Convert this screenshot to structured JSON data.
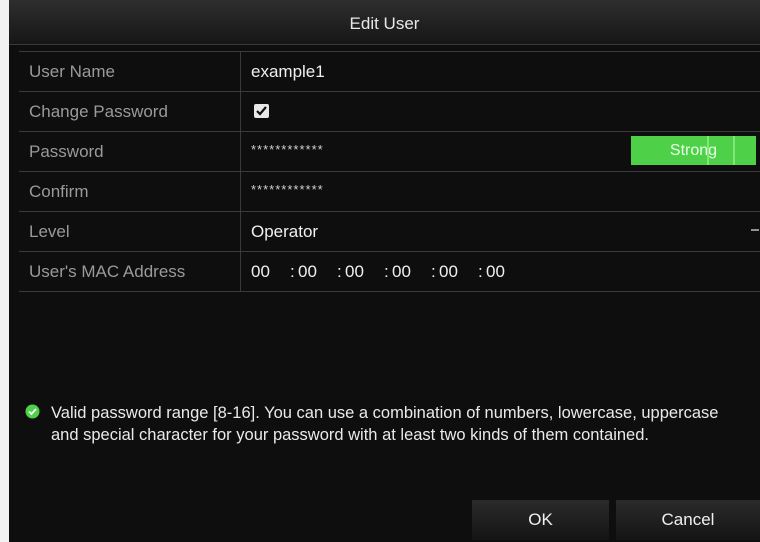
{
  "dialog": {
    "title": "Edit User",
    "fields": {
      "user_name": {
        "label": "User Name",
        "value": "example1"
      },
      "change_password": {
        "label": "Change Password",
        "checked": true
      },
      "password": {
        "label": "Password",
        "value": "************",
        "strength": "Strong",
        "strength_color": "#4ed048"
      },
      "confirm": {
        "label": "Confirm",
        "value": "************"
      },
      "level": {
        "label": "Level",
        "value": "Operator"
      },
      "mac": {
        "label": "User's MAC Address",
        "octets": [
          "00",
          "00",
          "00",
          "00",
          "00",
          "00"
        ]
      }
    },
    "hint": {
      "icon": "check-circle-icon",
      "text": "Valid password range [8-16]. You can use a combination of numbers, lowercase, uppercase and special character for your password with at least two kinds of them contained."
    },
    "buttons": {
      "ok": "OK",
      "cancel": "Cancel"
    }
  },
  "colors": {
    "background": "#0e0e0e",
    "label_text": "#9a9a9a",
    "value_text": "#f0f0f0",
    "hint_icon": "#4ed048"
  }
}
